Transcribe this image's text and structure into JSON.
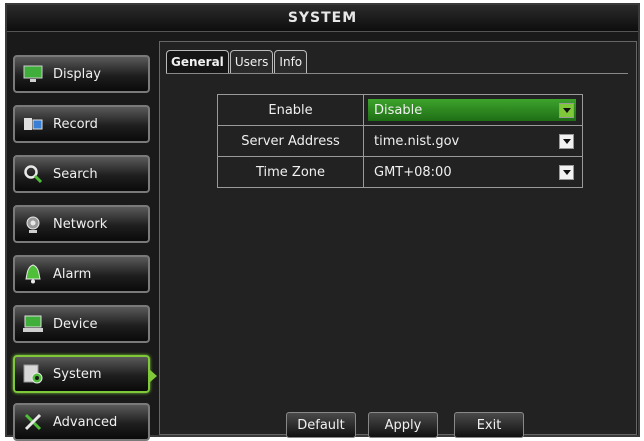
{
  "window": {
    "title": "SYSTEM"
  },
  "sidebar": {
    "items": [
      {
        "label": "Display",
        "icon": "monitor-icon"
      },
      {
        "label": "Record",
        "icon": "record-icon"
      },
      {
        "label": "Search",
        "icon": "search-icon"
      },
      {
        "label": "Network",
        "icon": "network-icon"
      },
      {
        "label": "Alarm",
        "icon": "alarm-icon"
      },
      {
        "label": "Device",
        "icon": "device-icon"
      },
      {
        "label": "System",
        "icon": "system-icon",
        "active": true
      },
      {
        "label": "Advanced",
        "icon": "tools-icon"
      }
    ]
  },
  "tabs": [
    {
      "label": "General",
      "active": true
    },
    {
      "label": "Users"
    },
    {
      "label": "Info"
    }
  ],
  "settings": {
    "enable": {
      "label": "Enable",
      "value": "Disable"
    },
    "server": {
      "label": "Server Address",
      "value": "time.nist.gov"
    },
    "timezone": {
      "label": "Time Zone",
      "value": "GMT+08:00"
    }
  },
  "buttons": {
    "default": "Default",
    "apply": "Apply",
    "exit": "Exit"
  },
  "colors": {
    "accent": "#7ec83a",
    "highlight": "#2f8f22",
    "background": "#1a1a1a"
  }
}
